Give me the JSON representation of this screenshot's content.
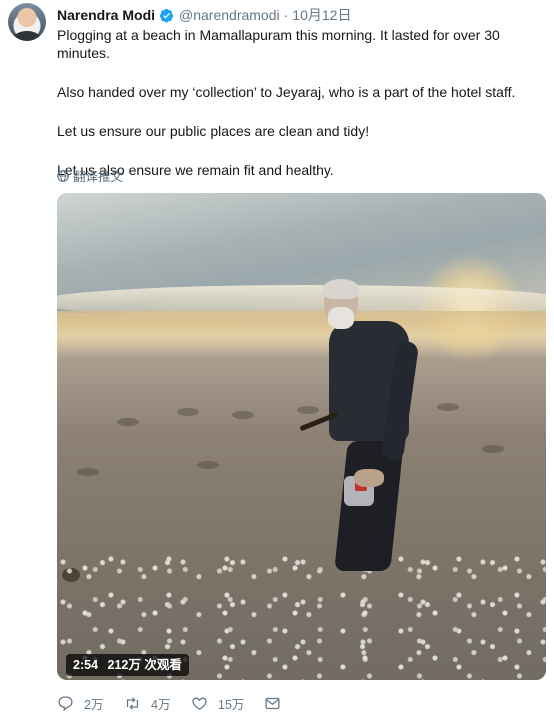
{
  "author": {
    "name": "Narendra Modi",
    "handle": "@narendramodi",
    "separator": "·",
    "date": "10月12日",
    "verified_icon": "verified-badge-icon",
    "verified_color": "#1da1f2"
  },
  "tweet": {
    "paragraphs": [
      "Plogging at a beach in Mamallapuram this morning. It lasted for over 30 minutes.",
      "Also handed over my ‘collection’ to Jeyaraj, who is a part of the hotel staff.",
      "Let us ensure our public places are clean and tidy!",
      "Let us also ensure we remain fit and healthy."
    ],
    "translate_label": "翻译推文",
    "translate_icon": "globe-icon"
  },
  "video": {
    "duration": "2:54",
    "views": "212万 次观看"
  },
  "actions": {
    "reply": {
      "icon": "reply-icon",
      "count": "2万"
    },
    "retweet": {
      "icon": "retweet-icon",
      "count": "4万"
    },
    "like": {
      "icon": "heart-icon",
      "count": "15万"
    },
    "message": {
      "icon": "envelope-icon"
    }
  },
  "colors": {
    "text": "#14171a",
    "secondary": "#657786",
    "accent": "#1da1f2"
  }
}
